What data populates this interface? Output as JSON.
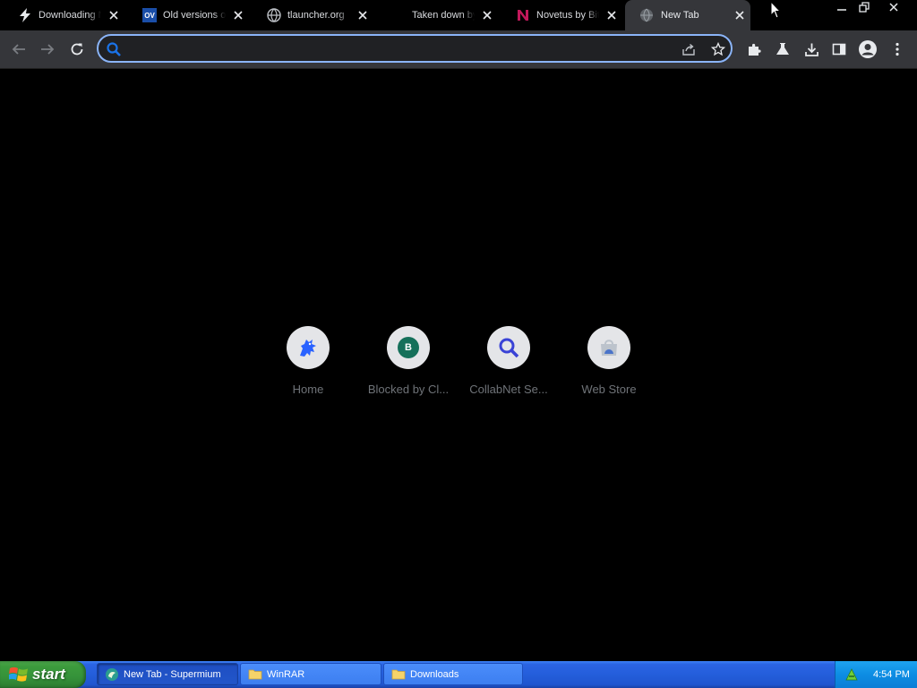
{
  "tabs": [
    {
      "title": "Downloading N",
      "favicon": "bolt-icon",
      "active": false
    },
    {
      "title": "Old versions o",
      "favicon": "ov-logo-icon",
      "active": false
    },
    {
      "title": "tlauncher.org",
      "favicon": "globe-icon",
      "active": false
    },
    {
      "title": "Taken down by",
      "favicon": "none",
      "active": false
    },
    {
      "title": "Novetus by Bit",
      "favicon": "novetus-n-icon",
      "active": false
    },
    {
      "title": "New Tab",
      "favicon": "globe-icon",
      "active": true
    }
  ],
  "tab_close_glyph": "✕",
  "favicon_labels": {
    "ov": "OV"
  },
  "omnibox": {
    "value": "",
    "placeholder": ""
  },
  "shortcuts": [
    {
      "label": "Home",
      "icon": "roblox-dino-icon"
    },
    {
      "label": "Blocked by Cl...",
      "icon": "letter-b-icon",
      "letter": "B"
    },
    {
      "label": "CollabNet Se...",
      "icon": "magnifier-icon"
    },
    {
      "label": "Web Store",
      "icon": "web-store-icon"
    }
  ],
  "taskbar": {
    "start_label": "start",
    "buttons": [
      {
        "label": "New Tab - Supermium",
        "icon": "supermium-icon",
        "active": true
      },
      {
        "label": "WinRAR",
        "icon": "folder-icon",
        "active": false
      },
      {
        "label": "Downloads",
        "icon": "folder-icon",
        "active": false
      }
    ],
    "clock": "4:54 PM"
  },
  "colors": {
    "page_bg": "#000000",
    "toolbar_bg": "#35363a",
    "omnibox_focus": "#8ab4f8",
    "xp_taskbar": "#245edb",
    "xp_start": "#3c9b3c"
  }
}
